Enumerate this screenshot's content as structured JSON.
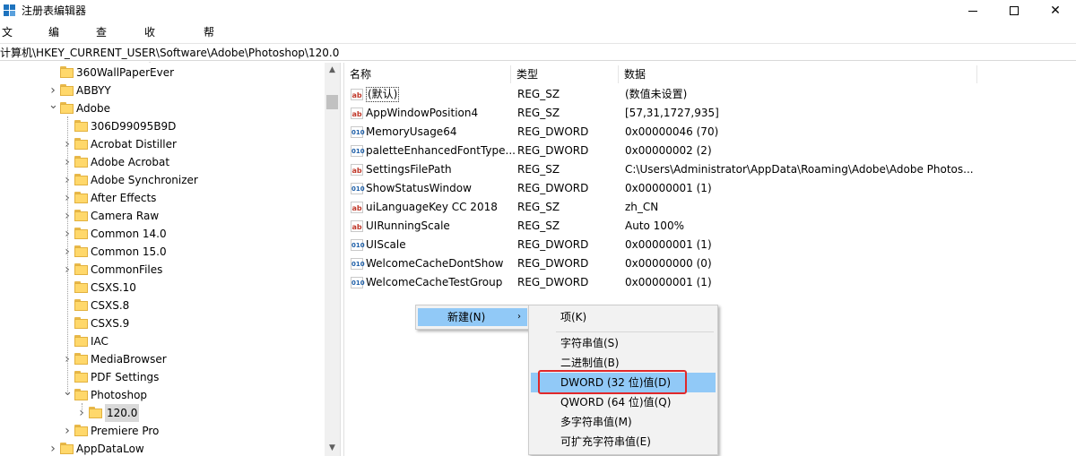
{
  "window": {
    "title": "注册表编辑器",
    "minimize_icon": "minimize-icon",
    "maximize_icon": "maximize-icon",
    "close_icon": "close-icon"
  },
  "menubar": [
    "文件(F)",
    "编辑(E)",
    "查看(V)",
    "收藏夹(A)",
    "帮助(H)"
  ],
  "address": "计算机\\HKEY_CURRENT_USER\\Software\\Adobe\\Photoshop\\120.0",
  "tree": {
    "items": [
      {
        "label": "360WallPaperEver",
        "expander": "none"
      },
      {
        "label": "ABBYY",
        "expander": "collapsed"
      },
      {
        "label": "Adobe",
        "expander": "expanded"
      },
      {
        "label": "306D99095B9D",
        "expander": "none"
      },
      {
        "label": "Acrobat Distiller",
        "expander": "collapsed"
      },
      {
        "label": "Adobe Acrobat",
        "expander": "collapsed"
      },
      {
        "label": "Adobe Synchronizer",
        "expander": "collapsed"
      },
      {
        "label": "After Effects",
        "expander": "collapsed"
      },
      {
        "label": "Camera Raw",
        "expander": "collapsed"
      },
      {
        "label": "Common 14.0",
        "expander": "collapsed"
      },
      {
        "label": "Common 15.0",
        "expander": "collapsed"
      },
      {
        "label": "CommonFiles",
        "expander": "collapsed"
      },
      {
        "label": "CSXS.10",
        "expander": "none"
      },
      {
        "label": "CSXS.8",
        "expander": "none"
      },
      {
        "label": "CSXS.9",
        "expander": "none"
      },
      {
        "label": "IAC",
        "expander": "none"
      },
      {
        "label": "MediaBrowser",
        "expander": "collapsed"
      },
      {
        "label": "PDF Settings",
        "expander": "none"
      },
      {
        "label": "Photoshop",
        "expander": "expanded"
      },
      {
        "label": "120.0",
        "expander": "collapsed",
        "selected": true
      },
      {
        "label": "Premiere Pro",
        "expander": "collapsed"
      },
      {
        "label": "AppDataLow",
        "expander": "collapsed"
      }
    ]
  },
  "list": {
    "columns": [
      "名称",
      "类型",
      "数据"
    ],
    "rows": [
      {
        "name": "(默认)",
        "type": "REG_SZ",
        "data": "(数值未设置)",
        "kind": "sz"
      },
      {
        "name": "AppWindowPosition4",
        "type": "REG_SZ",
        "data": "[57,31,1727,935]",
        "kind": "sz"
      },
      {
        "name": "MemoryUsage64",
        "type": "REG_DWORD",
        "data": "0x00000046 (70)",
        "kind": "dword"
      },
      {
        "name": "paletteEnhancedFontType...",
        "type": "REG_DWORD",
        "data": "0x00000002 (2)",
        "kind": "dword"
      },
      {
        "name": "SettingsFilePath",
        "type": "REG_SZ",
        "data": "C:\\Users\\Administrator\\AppData\\Roaming\\Adobe\\Adobe Photos...",
        "kind": "sz"
      },
      {
        "name": "ShowStatusWindow",
        "type": "REG_DWORD",
        "data": "0x00000001 (1)",
        "kind": "dword"
      },
      {
        "name": "uiLanguageKey CC 2018",
        "type": "REG_SZ",
        "data": "zh_CN",
        "kind": "sz"
      },
      {
        "name": "UIRunningScale",
        "type": "REG_SZ",
        "data": "Auto 100%",
        "kind": "sz"
      },
      {
        "name": "UIScale",
        "type": "REG_DWORD",
        "data": "0x00000001 (1)",
        "kind": "dword"
      },
      {
        "name": "WelcomeCacheDontShow",
        "type": "REG_DWORD",
        "data": "0x00000000 (0)",
        "kind": "dword"
      },
      {
        "name": "WelcomeCacheTestGroup",
        "type": "REG_DWORD",
        "data": "0x00000001 (1)",
        "kind": "dword"
      }
    ]
  },
  "context_menu": {
    "new_label": "新建(N)",
    "arrow": "›",
    "submenu": [
      "项(K)",
      "字符串值(S)",
      "二进制值(B)",
      "DWORD (32 位)值(D)",
      "QWORD (64 位)值(Q)",
      "多字符串值(M)",
      "可扩充字符串值(E)"
    ],
    "highlighted": "DWORD (32 位)值(D)"
  },
  "icons": {
    "sz_icon_text": "ab",
    "dword_icon_text": "010"
  },
  "colors": {
    "highlight": "#91c9f7",
    "red_box": "#e0282a",
    "folder": "#ffd86b"
  }
}
